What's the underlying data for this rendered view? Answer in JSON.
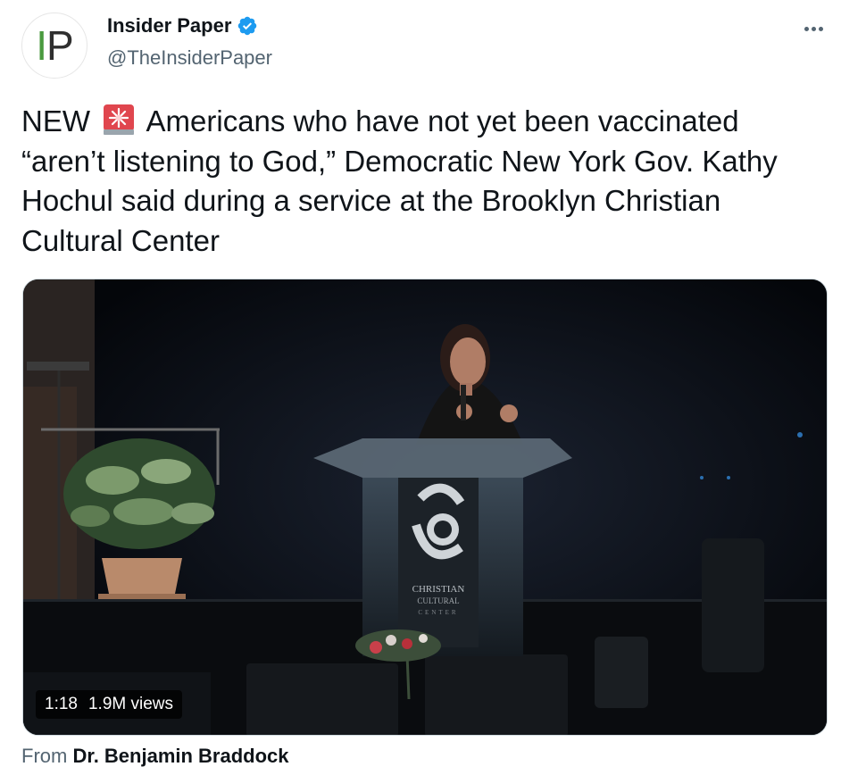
{
  "author": {
    "avatar_text_i": "I",
    "avatar_text_p": "P",
    "display_name": "Insider Paper",
    "handle": "@TheInsiderPaper"
  },
  "tweet": {
    "text_before_emoji": "NEW",
    "emoji_icon": "police-car-light-icon",
    "text_after_emoji": "Americans who have not yet been vaccinated “aren’t listening to God,” Democratic New York Gov. Kathy Hochul said during a service at the Brooklyn Christian Cultural Center"
  },
  "video": {
    "duration": "1:18",
    "views": "1.9M views",
    "podium_logo_line1": "CHRISTIAN",
    "podium_logo_line2": "CULTURAL",
    "podium_logo_line3": "CENTER"
  },
  "attribution": {
    "from_label": "From",
    "source_name": "Dr. Benjamin Braddock"
  },
  "colors": {
    "verified": "#1d9bf0",
    "secondary_text": "#536471",
    "logo_green": "#4a9a3f"
  }
}
